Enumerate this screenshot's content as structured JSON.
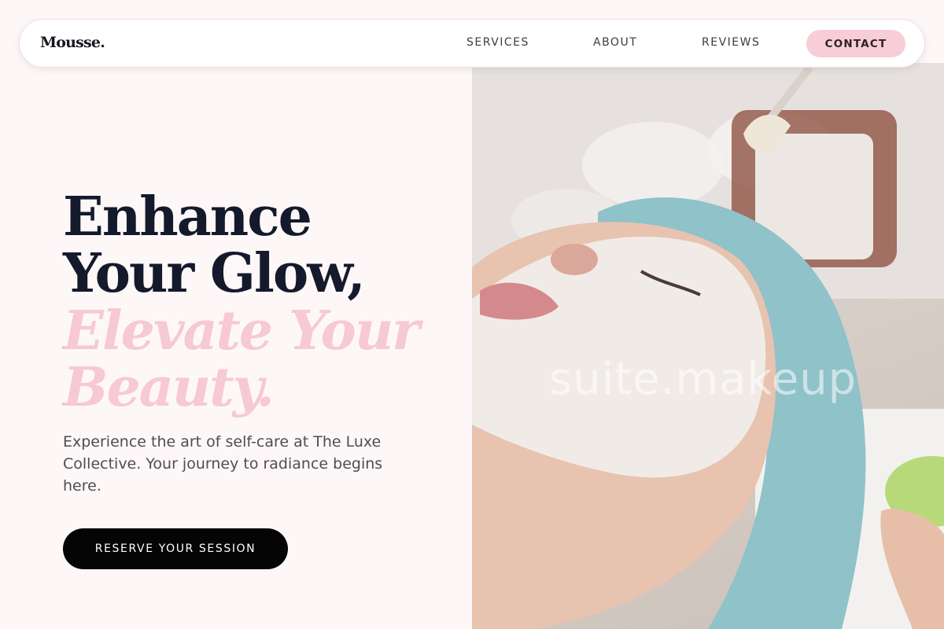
{
  "brand": {
    "logo": "Mousse."
  },
  "nav": {
    "links": [
      "SERVICES",
      "ABOUT",
      "REVIEWS"
    ],
    "contact_label": "CONTACT"
  },
  "hero": {
    "headline_line1": "Enhance",
    "headline_line2": "Your Glow,",
    "accent_line1": "Elevate Your",
    "accent_line2": "Beauty.",
    "subtext": "Experience the art of self-care at The Luxe Collective. Your journey to radiance begins here.",
    "cta_label": "RESERVE YOUR SESSION",
    "image_watermark": "suite.makeup"
  },
  "colors": {
    "background": "#fdf8f7",
    "accent_pink": "#f7c8d5",
    "contact_button": "#f8cdd8",
    "headline": "#141a2b",
    "cta_button": "#050505"
  }
}
